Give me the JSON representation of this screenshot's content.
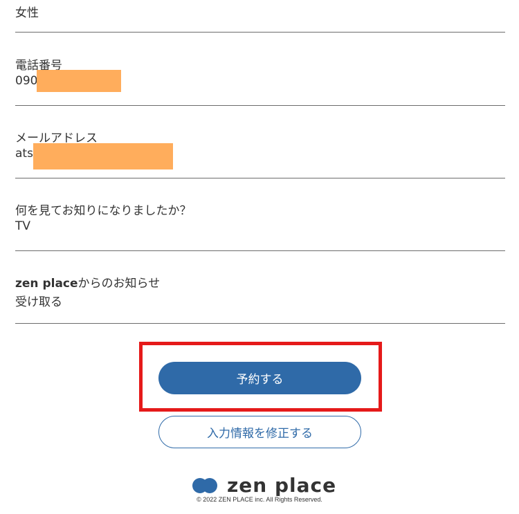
{
  "fields": {
    "gender": {
      "value": "女性"
    },
    "phone": {
      "label": "電話番号",
      "value_prefix": "090"
    },
    "email": {
      "label": "メールアドレス",
      "value_prefix": "ats"
    },
    "referral": {
      "label": "何を見てお知りになりましたか？",
      "value": "TV"
    },
    "newsletter": {
      "label_bold": "zen place",
      "label_rest": "からのお知らせ",
      "value": "受け取る"
    }
  },
  "actions": {
    "reserve_label": "予約する",
    "edit_label": "入力情報を修正する"
  },
  "footer": {
    "logo_text": "zen place",
    "copyright": "© 2022 ZEN PLACE inc. All Rights Reserved."
  },
  "colors": {
    "accent": "#2f6aa8",
    "highlight": "#e51a1a",
    "redaction": "#ffad5c",
    "divider": "#6b6b6b",
    "text": "#333333"
  },
  "icons": {
    "logo_mark": "two-overlapping-circles-icon"
  }
}
